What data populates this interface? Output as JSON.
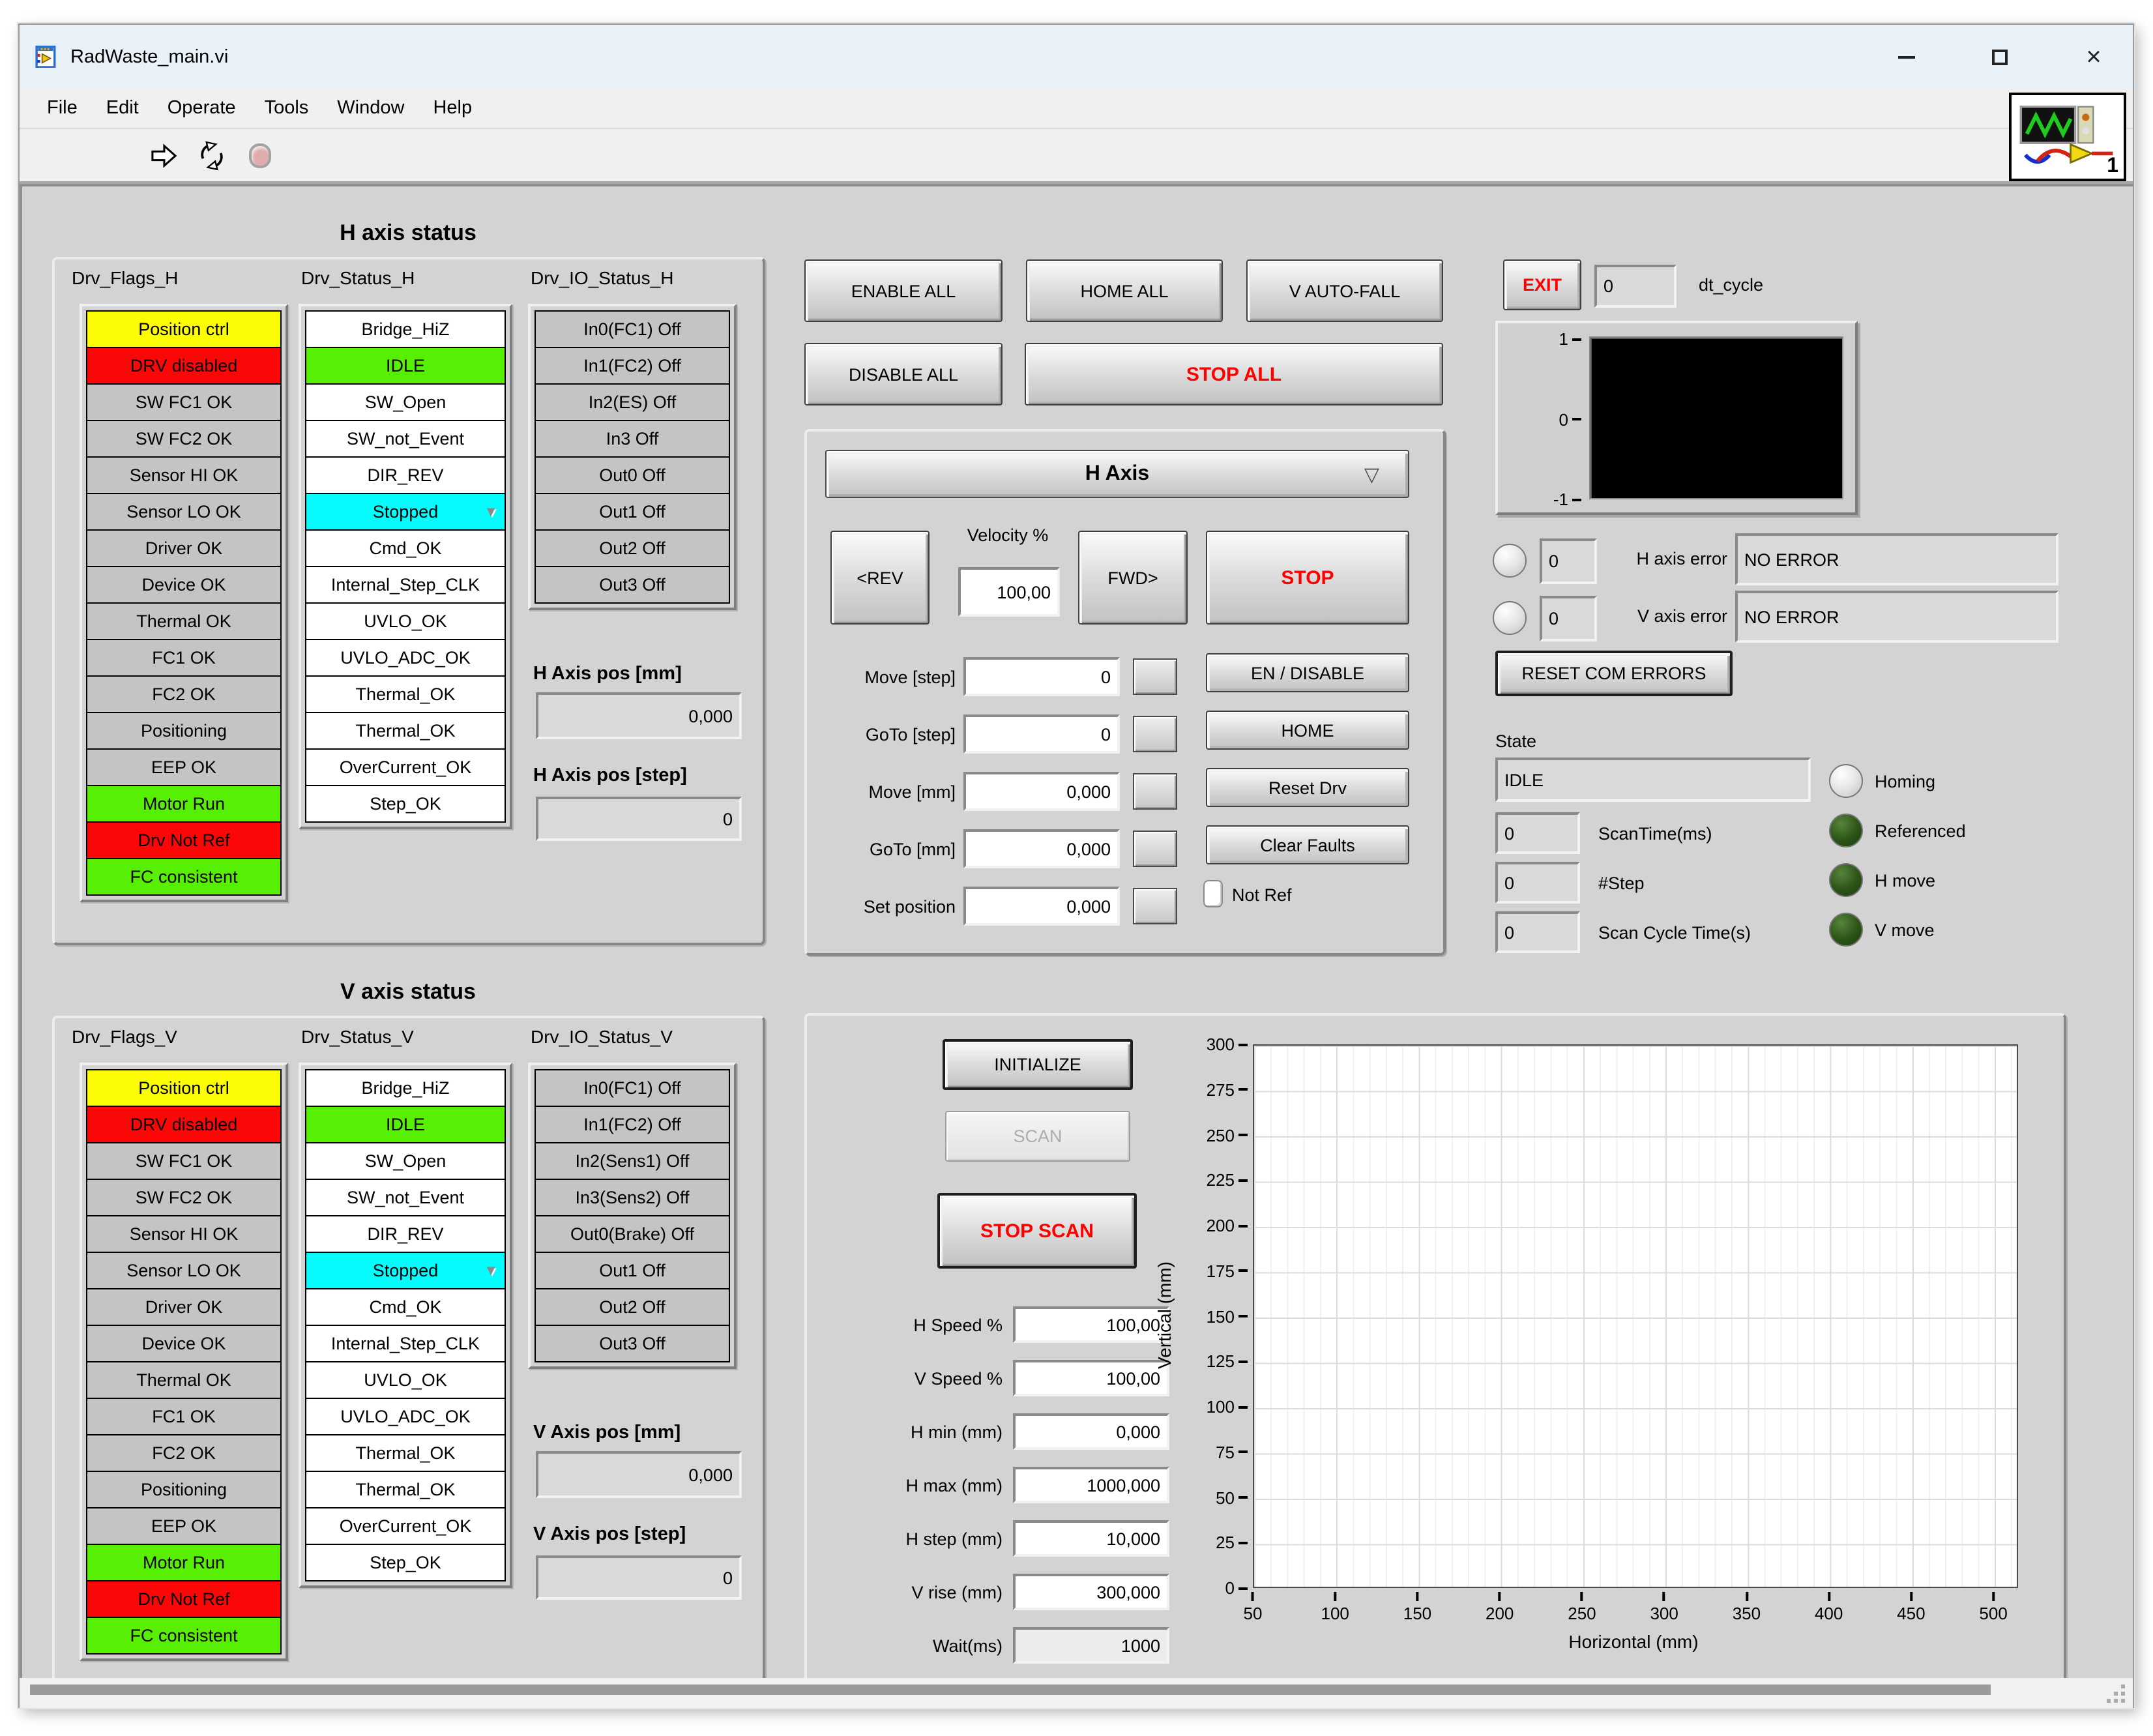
{
  "window": {
    "title": "RadWaste_main.vi",
    "menu": [
      "File",
      "Edit",
      "Operate",
      "Tools",
      "Window",
      "Help"
    ],
    "vi_badge_number": "1"
  },
  "icons": {
    "dropdown_open": "▽",
    "dropdown_item": "▼",
    "close": "×"
  },
  "colors": {
    "flag_yellow": "#fcfc05",
    "flag_red": "#fb0707",
    "flag_green": "#57f005",
    "status_cyan": "#06fcfc",
    "stop_text_red": "#ff0000",
    "panel_gray": "#d3d3d3",
    "led_dark_green": "#2c5417"
  },
  "h_axis": {
    "section_title": "H axis status",
    "flags_label": "Drv_Flags_H",
    "status_label": "Drv_Status_H",
    "io_label": "Drv_IO_Status_H",
    "flags": [
      {
        "t": "Position ctrl",
        "c": "yellow"
      },
      {
        "t": "DRV disabled",
        "c": "red"
      },
      {
        "t": "SW FC1 OK",
        "c": "gray"
      },
      {
        "t": "SW FC2 OK",
        "c": "gray"
      },
      {
        "t": "Sensor HI OK",
        "c": "gray"
      },
      {
        "t": "Sensor LO OK",
        "c": "gray"
      },
      {
        "t": "Driver OK",
        "c": "gray"
      },
      {
        "t": "Device OK",
        "c": "gray"
      },
      {
        "t": "Thermal OK",
        "c": "gray"
      },
      {
        "t": "FC1 OK",
        "c": "gray"
      },
      {
        "t": "FC2 OK",
        "c": "gray"
      },
      {
        "t": "Positioning",
        "c": "gray"
      },
      {
        "t": "EEP OK",
        "c": "gray"
      },
      {
        "t": "Motor Run",
        "c": "green"
      },
      {
        "t": "Drv Not Ref",
        "c": "red"
      },
      {
        "t": "FC consistent",
        "c": "green"
      }
    ],
    "status": [
      {
        "t": "Bridge_HiZ",
        "c": "white"
      },
      {
        "t": "IDLE",
        "c": "green"
      },
      {
        "t": "SW_Open",
        "c": "white"
      },
      {
        "t": "SW_not_Event",
        "c": "white"
      },
      {
        "t": "DIR_REV",
        "c": "white"
      },
      {
        "t": "Stopped",
        "c": "cyan",
        "dd": true
      },
      {
        "t": "Cmd_OK",
        "c": "white"
      },
      {
        "t": "Internal_Step_CLK",
        "c": "white"
      },
      {
        "t": "UVLO_OK",
        "c": "white"
      },
      {
        "t": "UVLO_ADC_OK",
        "c": "white"
      },
      {
        "t": "Thermal_OK",
        "c": "white"
      },
      {
        "t": "Thermal_OK",
        "c": "white"
      },
      {
        "t": "OverCurrent_OK",
        "c": "white"
      },
      {
        "t": "Step_OK",
        "c": "white"
      }
    ],
    "io": [
      "In0(FC1) Off",
      "In1(FC2) Off",
      "In2(ES) Off",
      "In3 Off",
      "Out0  Off",
      "Out1 Off",
      "Out2 Off",
      "Out3 Off"
    ],
    "pos_mm_label": "H Axis pos [mm]",
    "pos_mm": "0,000",
    "pos_step_label": "H Axis pos [step]",
    "pos_step": "0"
  },
  "v_axis": {
    "section_title": "V axis status",
    "flags_label": "Drv_Flags_V",
    "status_label": "Drv_Status_V",
    "io_label": "Drv_IO_Status_V",
    "flags": [
      {
        "t": "Position ctrl",
        "c": "yellow"
      },
      {
        "t": "DRV disabled",
        "c": "red"
      },
      {
        "t": "SW FC1 OK",
        "c": "gray"
      },
      {
        "t": "SW FC2 OK",
        "c": "gray"
      },
      {
        "t": "Sensor HI OK",
        "c": "gray"
      },
      {
        "t": "Sensor LO OK",
        "c": "gray"
      },
      {
        "t": "Driver OK",
        "c": "gray"
      },
      {
        "t": "Device OK",
        "c": "gray"
      },
      {
        "t": "Thermal OK",
        "c": "gray"
      },
      {
        "t": "FC1 OK",
        "c": "gray"
      },
      {
        "t": "FC2 OK",
        "c": "gray"
      },
      {
        "t": "Positioning",
        "c": "gray"
      },
      {
        "t": "EEP OK",
        "c": "gray"
      },
      {
        "t": "Motor Run",
        "c": "green"
      },
      {
        "t": "Drv Not Ref",
        "c": "red"
      },
      {
        "t": "FC consistent",
        "c": "green"
      }
    ],
    "status": [
      {
        "t": "Bridge_HiZ",
        "c": "white"
      },
      {
        "t": "IDLE",
        "c": "green"
      },
      {
        "t": "SW_Open",
        "c": "white"
      },
      {
        "t": "SW_not_Event",
        "c": "white"
      },
      {
        "t": "DIR_REV",
        "c": "white"
      },
      {
        "t": "Stopped",
        "c": "cyan",
        "dd": true
      },
      {
        "t": "Cmd_OK",
        "c": "white"
      },
      {
        "t": "Internal_Step_CLK",
        "c": "white"
      },
      {
        "t": "UVLO_OK",
        "c": "white"
      },
      {
        "t": "UVLO_ADC_OK",
        "c": "white"
      },
      {
        "t": "Thermal_OK",
        "c": "white"
      },
      {
        "t": "Thermal_OK",
        "c": "white"
      },
      {
        "t": "OverCurrent_OK",
        "c": "white"
      },
      {
        "t": "Step_OK",
        "c": "white"
      }
    ],
    "io": [
      "In0(FC1) Off",
      "In1(FC2) Off",
      "In2(Sens1) Off",
      "In3(Sens2) Off",
      "Out0(Brake)  Off",
      "Out1 Off",
      "Out2 Off",
      "Out3 Off"
    ],
    "pos_mm_label": "V Axis pos [mm]",
    "pos_mm": "0,000",
    "pos_step_label": "V Axis pos [step]",
    "pos_step": "0"
  },
  "global_controls": {
    "enable_all": "ENABLE ALL",
    "home_all": "HOME ALL",
    "v_auto_fall": "V AUTO-FALL",
    "disable_all": "DISABLE ALL",
    "stop_all": "STOP ALL"
  },
  "axis_control": {
    "selector": "H Axis",
    "rev": "<REV",
    "velocity_label": "Velocity %",
    "velocity": "100,00",
    "fwd": "FWD>",
    "stop": "STOP",
    "move_rows": [
      {
        "label": "Move [step]",
        "value": "0"
      },
      {
        "label": "GoTo [step]",
        "value": "0"
      },
      {
        "label": "Move [mm]",
        "value": "0,000"
      },
      {
        "label": "GoTo [mm]",
        "value": "0,000"
      },
      {
        "label": "Set position",
        "value": "0,000"
      }
    ],
    "action_buttons": [
      "EN / DISABLE",
      "HOME",
      "Reset Drv",
      "Clear Faults"
    ],
    "not_ref_label": "Not Ref"
  },
  "status_panel": {
    "exit": "EXIT",
    "dt_cycle_value": "0",
    "dt_cycle_label": "dt_cycle",
    "h_error": {
      "code": "0",
      "label": "H axis error",
      "message": "NO ERROR"
    },
    "v_error": {
      "code": "0",
      "label": "V axis error",
      "message": "NO ERROR"
    },
    "reset_com": "RESET COM ERRORS",
    "state_label": "State",
    "state_value": "IDLE",
    "counters": [
      {
        "value": "0",
        "label": "ScanTime(ms)"
      },
      {
        "value": "0",
        "label": "#Step"
      },
      {
        "value": "0",
        "label": "Scan Cycle Time(s)"
      }
    ],
    "leds": [
      {
        "label": "Homing",
        "c": "ledwhite"
      },
      {
        "label": "Referenced",
        "c": "ledgreen"
      },
      {
        "label": "H move",
        "c": "ledgreen"
      },
      {
        "label": "V move",
        "c": "ledgreen"
      }
    ]
  },
  "scan_panel": {
    "initialize": "INITIALIZE",
    "scan": "SCAN",
    "stop_scan": "STOP SCAN",
    "params": [
      {
        "label": "H Speed %",
        "value": "100,00"
      },
      {
        "label": "V Speed %",
        "value": "100,00"
      },
      {
        "label": "H min (mm)",
        "value": "0,000"
      },
      {
        "label": "H max (mm)",
        "value": "1000,000"
      },
      {
        "label": "H step (mm)",
        "value": "10,000"
      },
      {
        "label": "V rise (mm)",
        "value": "300,000"
      },
      {
        "label": "Wait(ms)",
        "value": "1000",
        "c": "dis"
      }
    ]
  },
  "chart_data": [
    {
      "type": "line",
      "y_ticks": [
        "1",
        "0",
        "-1"
      ],
      "ylim": [
        -1,
        1
      ],
      "series": [],
      "background": "#000000",
      "legend_position": "none"
    },
    {
      "type": "scatter",
      "xlabel": "Horizontal (mm)",
      "ylabel": "Vertical (mm)",
      "x_ticks": [
        50,
        100,
        150,
        200,
        250,
        300,
        350,
        400,
        450,
        500
      ],
      "y_ticks": [
        0,
        25,
        50,
        75,
        100,
        125,
        150,
        175,
        200,
        225,
        250,
        275,
        300
      ],
      "xlim": [
        50,
        500
      ],
      "ylim": [
        0,
        300
      ],
      "grid": true,
      "series": []
    }
  ]
}
